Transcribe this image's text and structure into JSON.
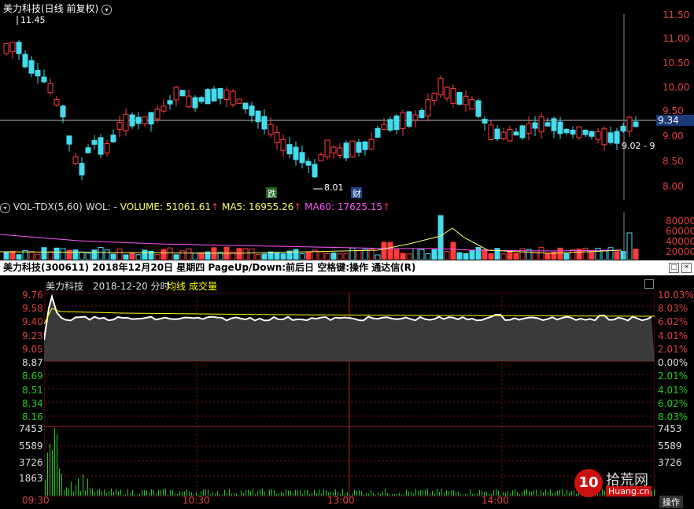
{
  "kline": {
    "title": "美力科技(日线 前复权)",
    "high_label": "11.45",
    "low_label": "8.01",
    "cur_price_box": "9.34",
    "range_label": "9.02 - 9.",
    "mark_die": "跌",
    "mark_cai": "财",
    "price_axis": [
      "11.50",
      "11.00",
      "10.50",
      "10.00",
      "9.50",
      "9.00",
      "8.50",
      "8.00"
    ],
    "candles": [
      [
        9.0,
        9.35,
        9.05,
        9.38,
        9.0
      ],
      [
        9.3,
        9.5,
        9.25,
        9.55,
        9.25
      ],
      [
        9.5,
        9.45,
        9.4,
        9.6,
        9.35
      ],
      [
        9.45,
        9.25,
        9.2,
        9.5,
        9.15
      ],
      [
        9.25,
        9.3,
        9.18,
        9.4,
        9.1
      ],
      [
        9.28,
        9.15,
        9.1,
        9.35,
        9.0
      ],
      [
        9.15,
        9.2,
        9.08,
        9.3,
        9.0
      ],
      [
        9.2,
        9.55,
        9.15,
        9.65,
        9.1
      ],
      [
        9.5,
        9.3,
        9.25,
        9.55,
        9.2
      ],
      [
        9.3,
        9.1,
        9.05,
        9.35,
        9.0
      ],
      [
        9.1,
        9.2,
        9.05,
        9.3,
        9.0
      ],
      [
        9.2,
        9.35,
        9.1,
        9.45,
        9.05
      ]
    ],
    "colors": {
      "up": "#ff3b3b",
      "down": "#44ddee",
      "ma": "#ffffff"
    }
  },
  "volume": {
    "header": {
      "name": "VOL-TDX(5,60)",
      "wol": "WOL: -",
      "volume": "VOLUME: 51061.61",
      "ma5": "MA5: 16955.26",
      "ma60": "MA60: 17625.15"
    },
    "axis": [
      "80000",
      "60000",
      "40000",
      "20000"
    ]
  },
  "intraday_bar": {
    "title": "美力科技(300611)  2018年12月20日 星期四  PageUp/Down:前后日 空格键:操作 通达信(R)"
  },
  "intraday": {
    "stock": "美力科技",
    "date_label": "2018-12-20 分时",
    "legend_avg": "均线",
    "legend_vol": "成交量",
    "price_axis": [
      "9.76",
      "9.58",
      "9.40",
      "9.23",
      "9.05",
      "8.87",
      "8.69",
      "8.51",
      "8.34",
      "8.16"
    ],
    "pct_axis": [
      "10.03%",
      "8.03%",
      "6.02%",
      "4.01%",
      "2.01%",
      "0.00%",
      "2.01%",
      "4.01%",
      "6.02%",
      "8.03%"
    ],
    "vol_axis": [
      "7453",
      "5589",
      "3726",
      "1863"
    ],
    "time_axis": [
      "09:30",
      "10:30",
      "13:00",
      "14:00"
    ],
    "colors": {
      "price": "#ffffff",
      "avg": "#ffff00",
      "vol": "#22cc22",
      "axis_up": "#e04040",
      "axis_down": "#22cc22"
    }
  },
  "watermark": {
    "brand": "拾荒网",
    "sub": "Huang.cn"
  },
  "operate": "操作"
}
